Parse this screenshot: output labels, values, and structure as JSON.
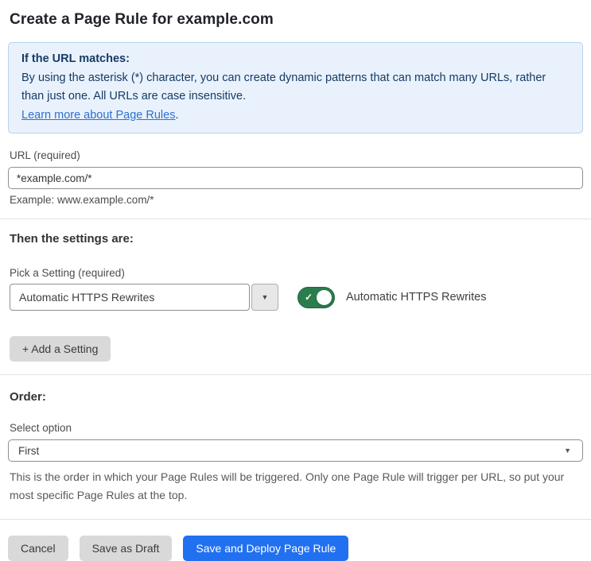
{
  "page": {
    "title": "Create a Page Rule for example.com"
  },
  "info_box": {
    "heading": "If the URL matches:",
    "body": "By using the asterisk (*) character, you can create dynamic patterns that can match many URLs, rather than just one. All URLs are case insensitive.",
    "link_label": "Learn more about Page Rules",
    "link_suffix": "."
  },
  "url_field": {
    "label": "URL (required)",
    "value": "*example.com/*",
    "helper": "Example: www.example.com/*"
  },
  "settings_section": {
    "heading": "Then the settings are:",
    "picker_label": "Pick a Setting (required)",
    "picker_value": "Automatic HTTPS Rewrites",
    "toggle_state": "on",
    "toggle_label": "Automatic HTTPS Rewrites",
    "add_setting_label": "+ Add a Setting"
  },
  "order_section": {
    "heading": "Order:",
    "select_label": "Select option",
    "select_value": "First",
    "helper": "This is the order in which your Page Rules will be triggered. Only one Page Rule will trigger per URL, so put your most specific Page Rules at the top."
  },
  "footer": {
    "cancel_label": "Cancel",
    "save_draft_label": "Save as Draft",
    "save_deploy_label": "Save and Deploy Page Rule"
  },
  "icons": {
    "picker_dropdown": "▼",
    "order_dropdown": "▼",
    "toggle_check": "✓"
  },
  "colors": {
    "info_bg": "#e9f2fc",
    "info_border": "#b5d3ef",
    "info_text": "#163a66",
    "link_blue": "#2d6fd2",
    "toggle_green": "#2b7d4e",
    "primary_blue": "#2170f0",
    "button_gray": "#d9d9d9"
  }
}
